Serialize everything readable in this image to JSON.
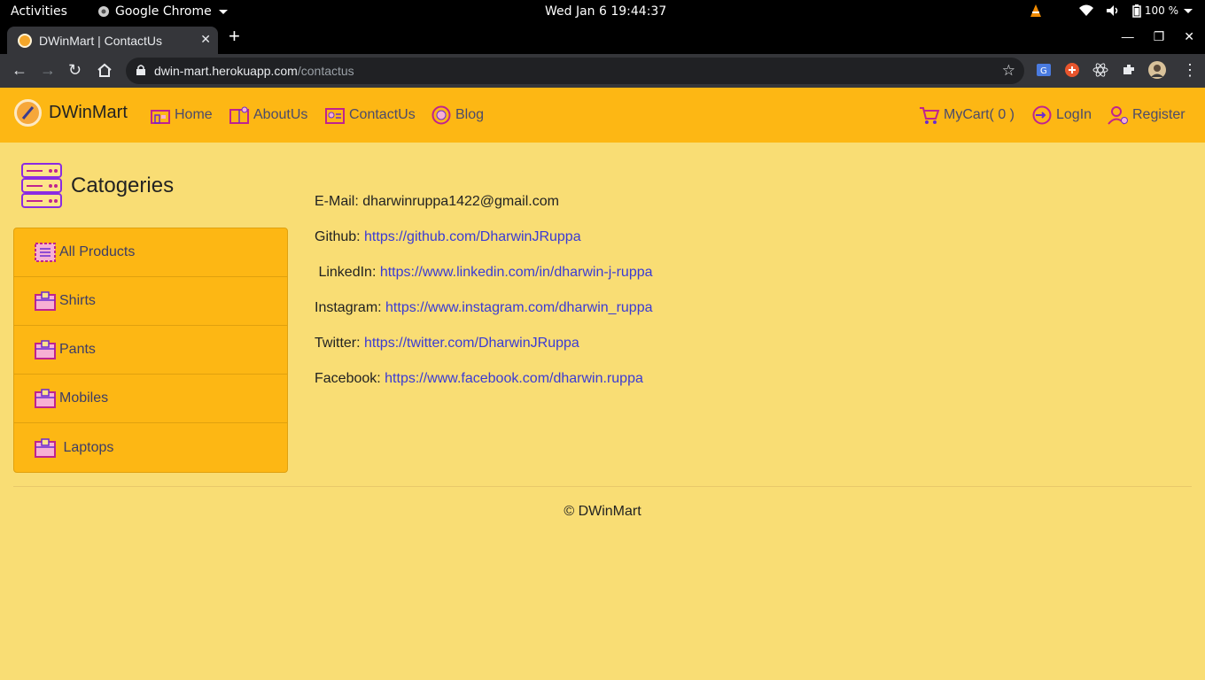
{
  "os_bar": {
    "activities": "Activities",
    "app_name": "Google Chrome",
    "clock": "Wed Jan 6  19:44:37",
    "battery": "100 %"
  },
  "browser": {
    "tab_title": "DWinMart | ContactUs",
    "url_host": "dwin-mart.herokuapp.com",
    "url_path": "/contactus"
  },
  "site": {
    "brand": "DWinMart",
    "nav_left": [
      "Home",
      "AboutUs",
      "ContactUs",
      "Blog"
    ],
    "cart_label": "MyCart( 0 )",
    "login_label": "LogIn",
    "register_label": "Register",
    "accent_color": "#fdb714",
    "page_bg": "#f9dd74"
  },
  "categories": {
    "title": "Catogeries",
    "items": [
      "All Products",
      "Shirts",
      "Pants",
      "Mobiles",
      " Laptops"
    ]
  },
  "contact": {
    "email_label": "E-Mail: ",
    "email_value": "dharwinruppa1422@gmail.com",
    "github_label": "Github: ",
    "github_link": "https://github.com/DharwinJRuppa",
    "linkedin_label": " LinkedIn: ",
    "linkedin_link": "https://www.linkedin.com/in/dharwin-j-ruppa",
    "instagram_label": "Instagram: ",
    "instagram_link": "https://www.instagram.com/dharwin_ruppa",
    "twitter_label": "Twitter: ",
    "twitter_link": "https://twitter.com/DharwinJRuppa",
    "facebook_label": "Facebook: ",
    "facebook_link": "https://www.facebook.com/dharwin.ruppa"
  },
  "footer": {
    "text": "© DWinMart"
  }
}
